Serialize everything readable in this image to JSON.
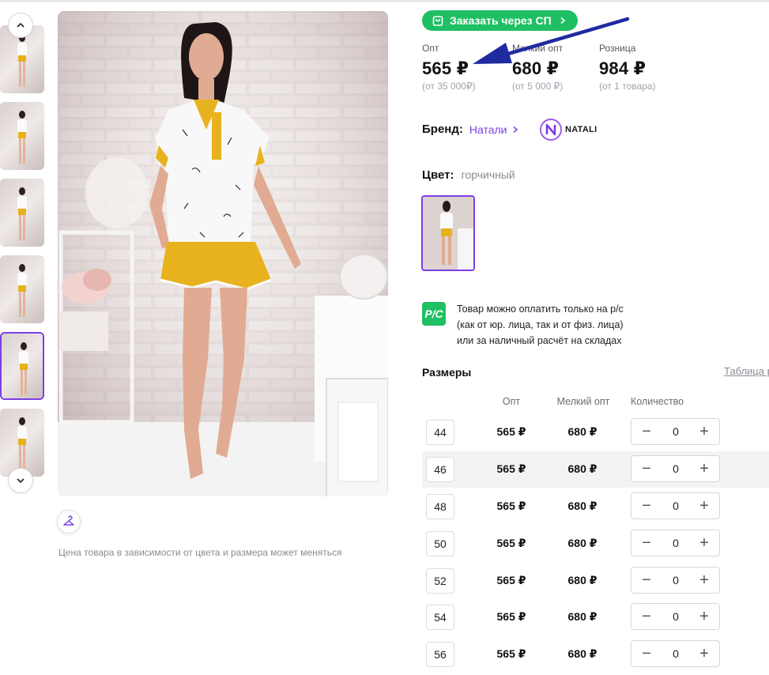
{
  "order_button": {
    "label": "Заказать через СП",
    "icon": "shopping-bag-icon"
  },
  "prices": [
    {
      "label": "Опт",
      "value": "565 ₽",
      "min": "(от 35 000₽)"
    },
    {
      "label": "Мелкий опт",
      "value": "680 ₽",
      "min": "(от 5 000 ₽)"
    },
    {
      "label": "Розница",
      "value": "984 ₽",
      "min": "(от 1 товара)"
    }
  ],
  "brand": {
    "label": "Бренд:",
    "name": "Натали",
    "logo_letter": "N",
    "logo_text": "NATALI"
  },
  "color": {
    "label": "Цвет:",
    "value": "горчичный"
  },
  "payment_note": {
    "icon_text": "Р/С",
    "lines": [
      "Товар можно оплатить только на р/с",
      "(как от юр. лица, так и от физ. лица)",
      "или за наличный расчёт на складах"
    ]
  },
  "sizes": {
    "title": "Размеры",
    "table_link": "Таблица р",
    "columns": {
      "opt": "Опт",
      "small_opt": "Мелкий опт",
      "quantity": "Количество"
    },
    "rows": [
      {
        "size": "44",
        "opt": "565 ₽",
        "small_opt": "680 ₽",
        "qty": "0"
      },
      {
        "size": "46",
        "opt": "565 ₽",
        "small_opt": "680 ₽",
        "qty": "0"
      },
      {
        "size": "48",
        "opt": "565 ₽",
        "small_opt": "680 ₽",
        "qty": "0"
      },
      {
        "size": "50",
        "opt": "565 ₽",
        "small_opt": "680 ₽",
        "qty": "0"
      },
      {
        "size": "52",
        "opt": "565 ₽",
        "small_opt": "680 ₽",
        "qty": "0"
      },
      {
        "size": "54",
        "opt": "565 ₽",
        "small_opt": "680 ₽",
        "qty": "0"
      },
      {
        "size": "56",
        "opt": "565 ₽",
        "small_opt": "680 ₽",
        "qty": "0"
      }
    ]
  },
  "price_note": "Цена товара в зависимости от цвета и размера может меняться",
  "colors": {
    "accent": "#7b3fe4",
    "green": "#1fbf63",
    "arrow": "#1f2aa0"
  }
}
